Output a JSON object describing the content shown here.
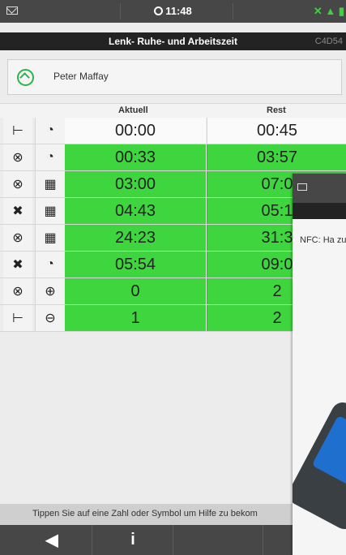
{
  "status_bar": {
    "time": "11:48"
  },
  "title_bar": {
    "title": "Lenk- Ruhe- und Arbeitszeit",
    "device_id": "C4D54"
  },
  "driver": {
    "name": "Peter Maffay"
  },
  "table": {
    "headers": {
      "current": "Aktuell",
      "rest": "Rest"
    },
    "rows": [
      {
        "icon1": "bed-icon",
        "icon2": "clock-icon",
        "current": "00:00",
        "rest": "00:45",
        "color": "white"
      },
      {
        "icon1": "steering-wheel-icon",
        "icon2": "clock-icon",
        "current": "00:33",
        "rest": "03:57",
        "color": "green"
      },
      {
        "icon1": "steering-wheel-icon",
        "icon2": "calendar-day-icon",
        "current": "03:00",
        "rest": "07:0",
        "color": "green"
      },
      {
        "icon1": "tools-icon",
        "icon2": "calendar-day-icon",
        "current": "04:43",
        "rest": "05:1",
        "color": "green"
      },
      {
        "icon1": "steering-wheel-icon",
        "icon2": "calendar-week-icon",
        "current": "24:23",
        "rest": "31:3",
        "color": "green"
      },
      {
        "icon1": "tools-icon",
        "icon2": "clock-icon",
        "current": "05:54",
        "rest": "09:0",
        "color": "green"
      },
      {
        "icon1": "steering-wheel-icon",
        "icon2": "plus-circle-icon",
        "current": "0",
        "rest": "2",
        "color": "green"
      },
      {
        "icon1": "bed-icon",
        "icon2": "minus-circle-icon",
        "current": "1",
        "rest": "2",
        "color": "green"
      }
    ]
  },
  "hint": "Tippen Sie auf eine Zahl oder Symbol um Hilfe zu bekom",
  "nav": {
    "back_icon": "arrow-left-icon",
    "info_label": "i"
  },
  "overlay": {
    "text": "NFC: Ha zu lesen"
  },
  "colors": {
    "green": "#3fd53f",
    "status_bar": "#474747",
    "title_bar": "#232323",
    "accent": "#2db34a"
  }
}
